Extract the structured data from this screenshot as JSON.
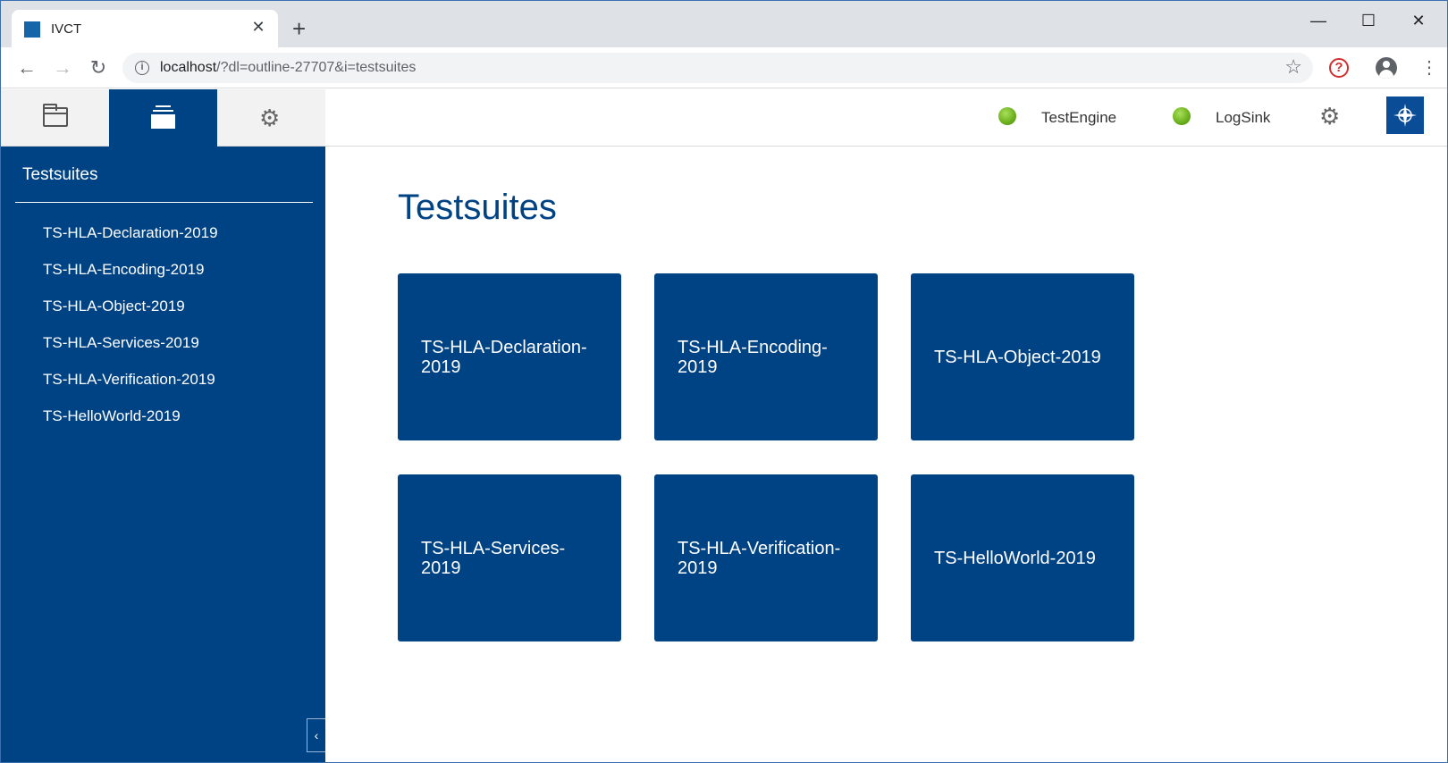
{
  "browser": {
    "tab_title": "IVCT",
    "tab_close": "✕",
    "new_tab": "+",
    "url_host": "localhost",
    "url_path": "/?dl=outline-27707&i=testsuites"
  },
  "sidebar": {
    "title": "Testsuites",
    "items": [
      "TS-HLA-Declaration-2019",
      "TS-HLA-Encoding-2019",
      "TS-HLA-Object-2019",
      "TS-HLA-Services-2019",
      "TS-HLA-Verification-2019",
      "TS-HelloWorld-2019"
    ]
  },
  "topbar": {
    "status": [
      {
        "label": "TestEngine",
        "color": "#7ac231"
      },
      {
        "label": "LogSink",
        "color": "#7ac231"
      }
    ]
  },
  "main": {
    "title": "Testsuites",
    "cards": [
      "TS-HLA-Declaration-2019",
      "TS-HLA-Encoding-2019",
      "TS-HLA-Object-2019",
      "TS-HLA-Services-2019",
      "TS-HLA-Verification-2019",
      "TS-HelloWorld-2019"
    ]
  },
  "colors": {
    "brand_blue": "#004385",
    "status_green": "#7ac231"
  },
  "icons": [
    "folder-icon",
    "stack-icon",
    "gear-icon",
    "nato-logo-icon",
    "chevron-left-icon"
  ]
}
